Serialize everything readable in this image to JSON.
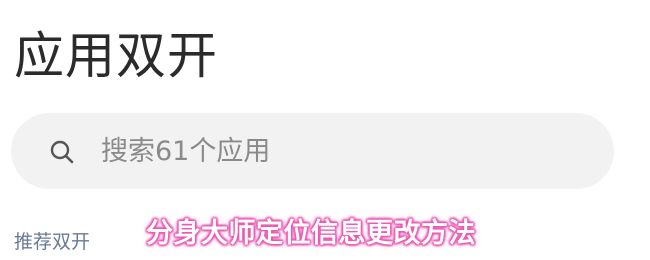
{
  "header": {
    "title": "应用双开"
  },
  "search": {
    "icon": "search-icon",
    "placeholder": "搜索61个应用",
    "value": ""
  },
  "section": {
    "label": "推荐双开"
  },
  "overlay": {
    "caption": "分身大师定位信息更改方法",
    "text_color": "#ffffff",
    "glow_color": "#f05fb8"
  },
  "colors": {
    "background": "#ffffff",
    "search_bg": "#f2f2f2",
    "title_text": "#2b2b2b",
    "placeholder_text": "#8a8a8a",
    "section_label": "#6a7a96"
  }
}
